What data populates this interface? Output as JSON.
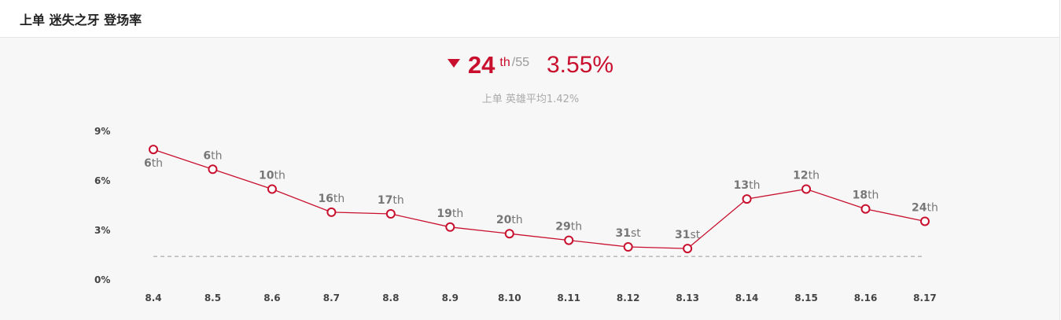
{
  "header": {
    "title": "上单 迷失之牙 登场率"
  },
  "summary": {
    "rank": "24",
    "rank_suffix": "th",
    "rank_total": "/55",
    "rate": "3.55%",
    "trend": "down",
    "subline": "上单 英雄平均1.42%"
  },
  "colors": {
    "accent": "#c8102e",
    "background": "#f7f7f7",
    "average_line": "#999999"
  },
  "chart_data": {
    "type": "line",
    "categories": [
      "8.4",
      "8.5",
      "8.6",
      "8.7",
      "8.8",
      "8.9",
      "8.10",
      "8.11",
      "8.12",
      "8.13",
      "8.14",
      "8.15",
      "8.16",
      "8.17"
    ],
    "values": [
      7.9,
      6.7,
      5.5,
      4.1,
      4.0,
      3.2,
      2.8,
      2.4,
      2.0,
      1.9,
      4.9,
      5.5,
      4.3,
      3.55
    ],
    "ranks": [
      "6",
      "6",
      "10",
      "16",
      "17",
      "19",
      "20",
      "29",
      "31",
      "31",
      "13",
      "12",
      "18",
      "24"
    ],
    "rank_suffixes": [
      "th",
      "th",
      "th",
      "th",
      "th",
      "th",
      "th",
      "th",
      "st",
      "st",
      "th",
      "th",
      "th",
      "th"
    ],
    "average": 1.42,
    "ylim": [
      0,
      9
    ],
    "yticks": [
      0,
      3,
      6,
      9
    ],
    "ytick_labels": [
      "0%",
      "3%",
      "6%",
      "9%"
    ],
    "grid": false
  }
}
